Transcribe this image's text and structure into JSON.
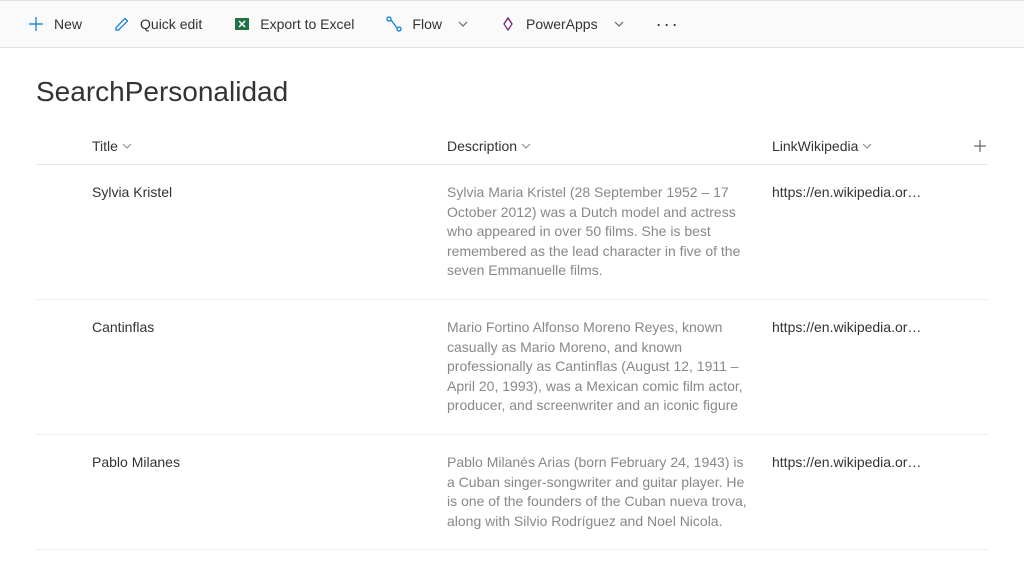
{
  "toolbar": {
    "new_label": "New",
    "quick_edit_label": "Quick edit",
    "export_label": "Export to Excel",
    "flow_label": "Flow",
    "powerapps_label": "PowerApps"
  },
  "page": {
    "title": "SearchPersonalidad"
  },
  "columns": {
    "title": "Title",
    "description": "Description",
    "linkwikipedia": "LinkWikipedia"
  },
  "rows": [
    {
      "title": "Sylvia Kristel",
      "description": "Sylvia Maria Kristel (28 September 1952 – 17 October 2012) was a Dutch model and actress who appeared in over 50 films. She is best remembered as the lead character in five of the seven Emmanuelle films.",
      "link": "https://en.wikipedia.or…"
    },
    {
      "title": "Cantinflas",
      "description": "Mario Fortino Alfonso Moreno Reyes, known casually as Mario Moreno, and known professionally as Cantinflas (August 12, 1911 – April 20, 1993), was a Mexican comic film actor, producer, and screenwriter and an iconic figure",
      "link": "https://en.wikipedia.or…"
    },
    {
      "title": "Pablo Milanes",
      "description": "Pablo Milanés Arias (born February 24, 1943) is a Cuban singer-songwriter and guitar player. He is one of the founders of the Cuban nueva trova, along with Silvio Rodríguez and Noel Nicola.",
      "link": "https://en.wikipedia.or…"
    }
  ],
  "colors": {
    "accent": "#0078d4"
  }
}
